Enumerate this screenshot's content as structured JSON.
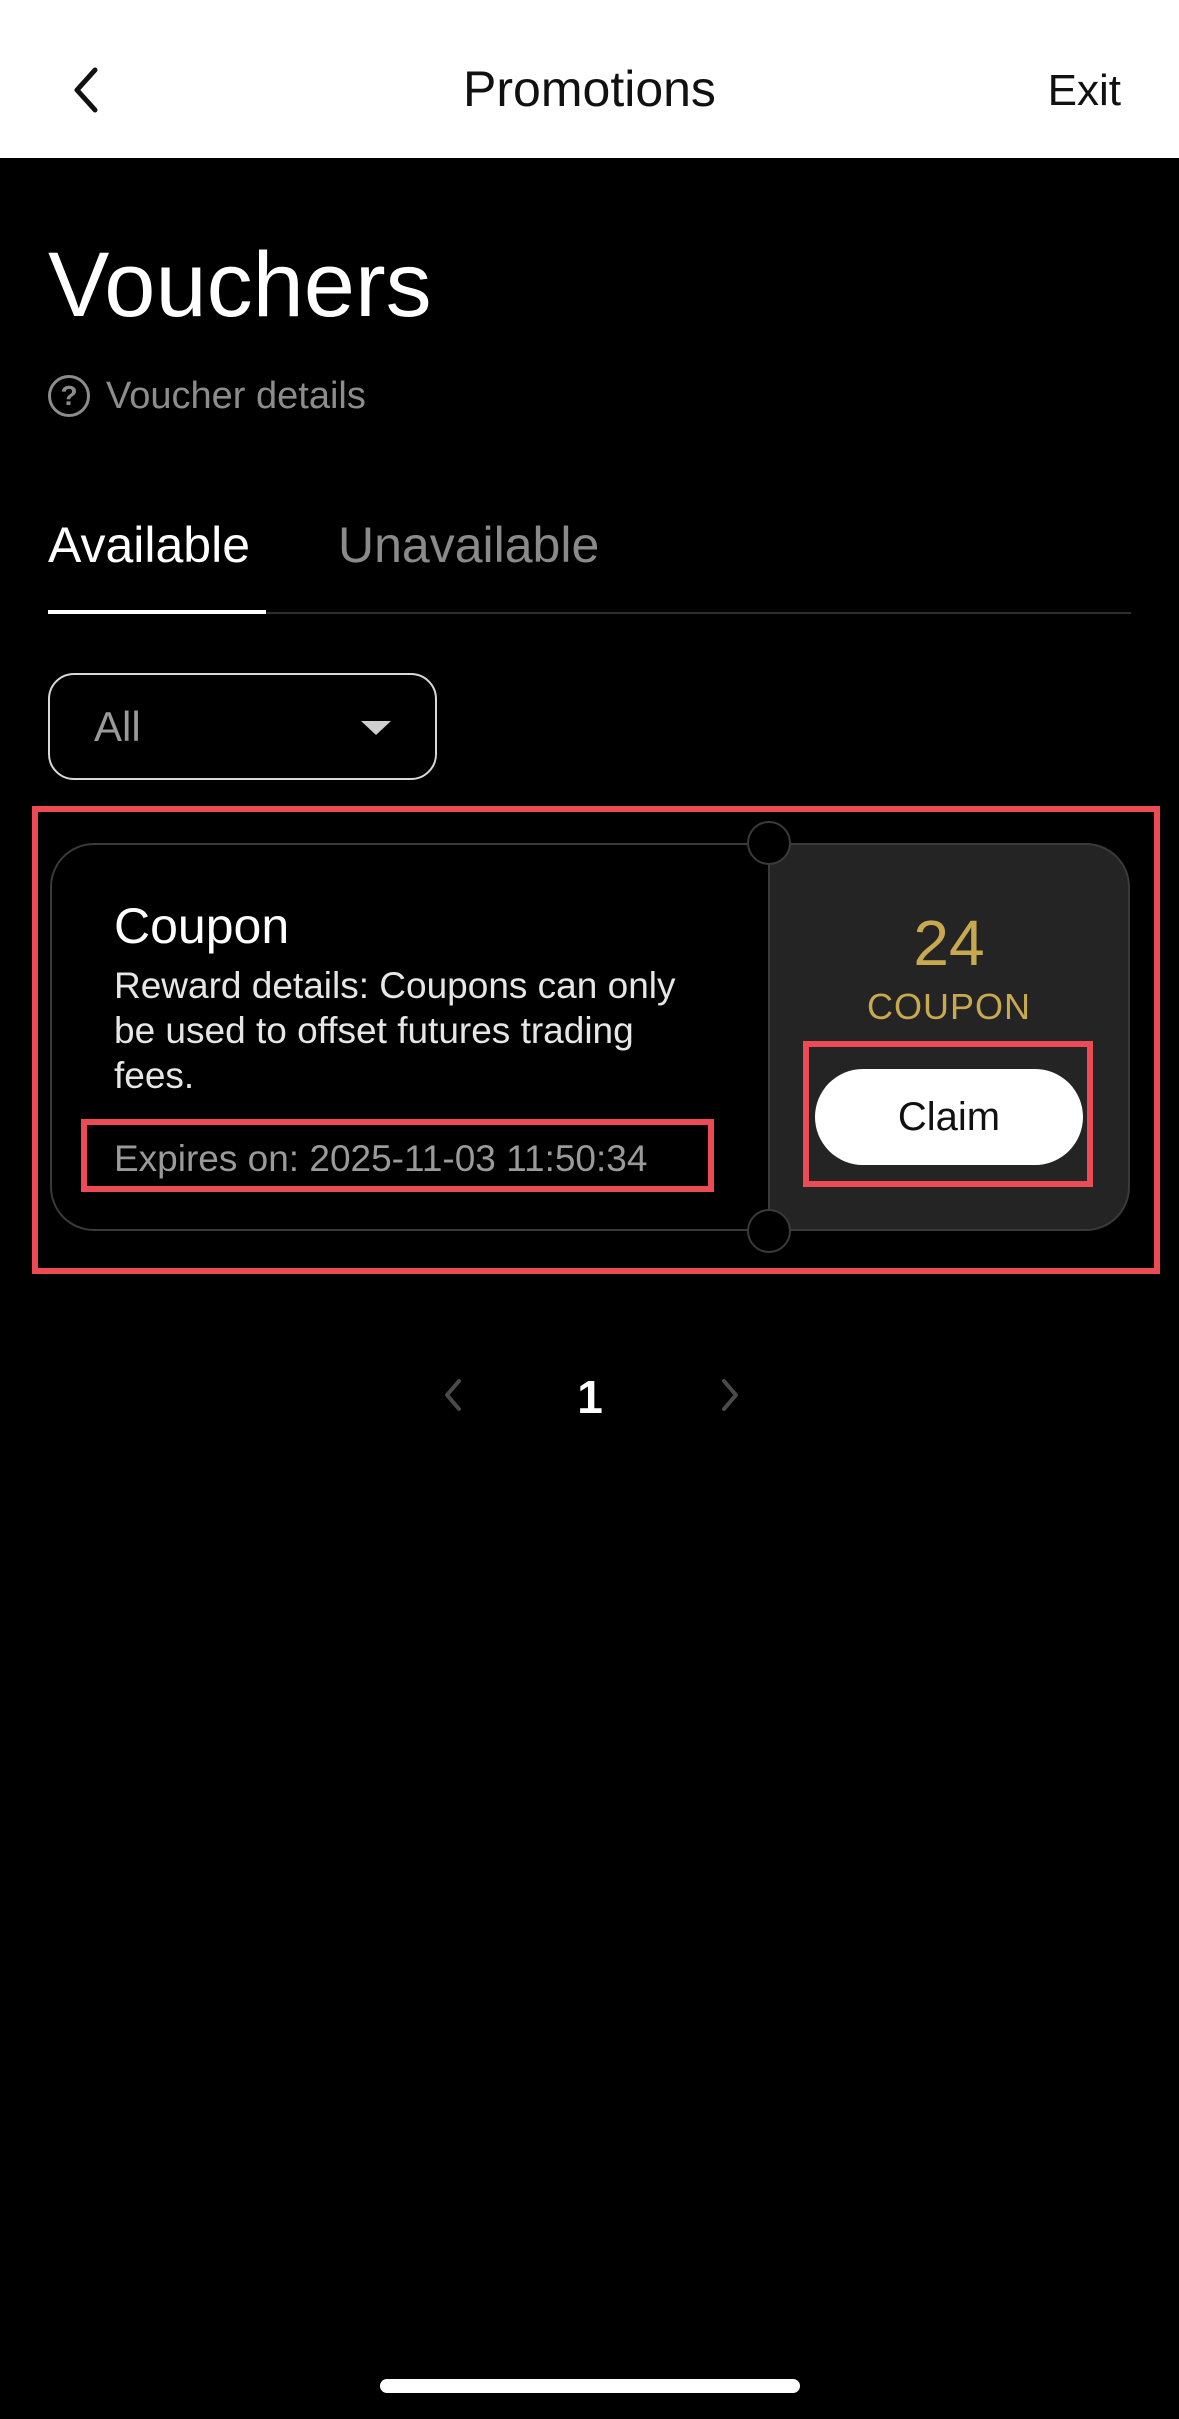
{
  "header": {
    "title": "Promotions",
    "exit_label": "Exit"
  },
  "page": {
    "title": "Vouchers",
    "details_link": "Voucher details"
  },
  "tabs": [
    {
      "label": "Available",
      "active": true
    },
    {
      "label": "Unavailable",
      "active": false
    }
  ],
  "filter": {
    "selected": "All"
  },
  "voucher": {
    "title": "Coupon",
    "description": "Reward details: Coupons can only be used to offset futures trading fees.",
    "expiry": "Expires on: 2025-11-03 11:50:34",
    "amount": "24",
    "unit": "COUPON",
    "claim_label": "Claim"
  },
  "pagination": {
    "current_page": "1"
  },
  "colors": {
    "accent_gold": "#c8a94f",
    "highlight": "#ec4b55",
    "background": "#000000"
  }
}
